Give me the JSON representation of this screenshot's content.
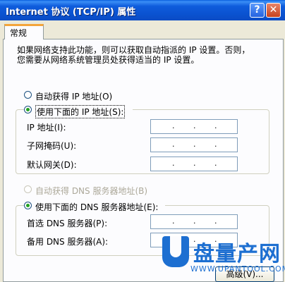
{
  "window": {
    "title": "Internet 协议 (TCP/IP) 属性",
    "help_glyph": "?",
    "close_glyph": "✕"
  },
  "tabs": [
    {
      "label": "常规",
      "active": true
    }
  ],
  "intro": {
    "line1": "如果网络支持此功能，则可以获取自动指派的 IP 设置。否则，",
    "line2": "您需要从网络系统管理员处获得适当的 IP 设置。"
  },
  "ip_mode": {
    "auto_label": "自动获得 IP 地址(O)",
    "manual_label": "使用下面的 IP 地址(S):",
    "selected": "manual"
  },
  "ip_fields": [
    {
      "label": "IP 地址(I):",
      "value": ""
    },
    {
      "label": "子网掩码(U):",
      "value": ""
    },
    {
      "label": "默认网关(D):",
      "value": ""
    }
  ],
  "dns_mode": {
    "auto_label": "自动获得 DNS 服务器地址(B)",
    "manual_label": "使用下面的 DNS 服务器地址(E):",
    "selected": "manual"
  },
  "dns_fields": [
    {
      "label": "首选 DNS 服务器(P):",
      "value": ""
    },
    {
      "label": "备用 DNS 服务器(A):",
      "value": ""
    }
  ],
  "buttons": {
    "advanced": "高级(V)..."
  },
  "watermark": {
    "text": "盘量产网",
    "url": "WWW.UPANTOOL.COM"
  },
  "colors": {
    "title_bar": "#0a52d0",
    "dialog_bg": "#ece9d8",
    "radio_dot": "#21a121",
    "tab_accent": "#f3a43a"
  }
}
